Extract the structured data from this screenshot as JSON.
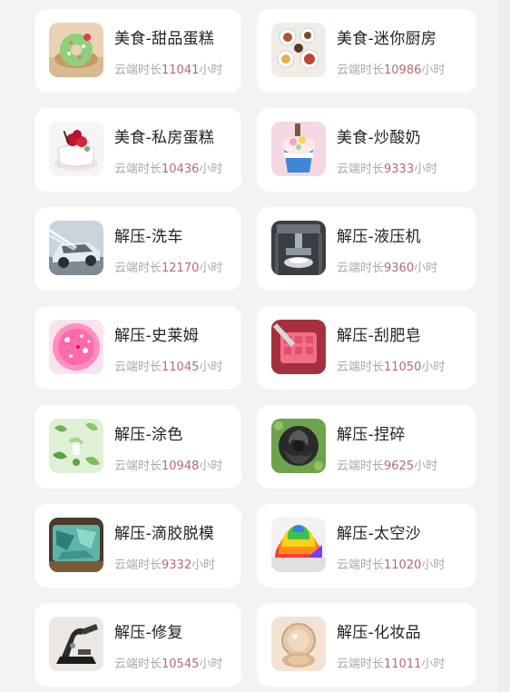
{
  "theme": {
    "page_bg": "#f3f3f5",
    "card_bg": "#ffffff",
    "title_color": "#222222",
    "meta_color": "#a9a9ad",
    "hours_color": "#b56a72"
  },
  "meta_prefix": "云端时长",
  "meta_suffix": "小时",
  "items": [
    {
      "title": "美食-甜品蛋糕",
      "hours": "11041",
      "icon": "donut-cake-image"
    },
    {
      "title": "美食-迷你厨房",
      "hours": "10986",
      "icon": "mini-kitchen-image"
    },
    {
      "title": "美食-私房蛋糕",
      "hours": "10436",
      "icon": "berry-cake-image"
    },
    {
      "title": "美食-炒酸奶",
      "hours": "9333",
      "icon": "fried-yogurt-image"
    },
    {
      "title": "解压-洗车",
      "hours": "12170",
      "icon": "car-wash-image"
    },
    {
      "title": "解压-液压机",
      "hours": "9360",
      "icon": "hydraulic-press-image"
    },
    {
      "title": "解压-史莱姆",
      "hours": "11045",
      "icon": "slime-image"
    },
    {
      "title": "解压-刮肥皂",
      "hours": "11050",
      "icon": "soap-cutting-image"
    },
    {
      "title": "解压-涂色",
      "hours": "10948",
      "icon": "coloring-image"
    },
    {
      "title": "解压-捏碎",
      "hours": "9625",
      "icon": "crush-image"
    },
    {
      "title": "解压-滴胶脱模",
      "hours": "9332",
      "icon": "resin-mold-image"
    },
    {
      "title": "解压-太空沙",
      "hours": "11020",
      "icon": "kinetic-sand-image"
    },
    {
      "title": "解压-修复",
      "hours": "10545",
      "icon": "repair-tool-image"
    },
    {
      "title": "解压-化妆品",
      "hours": "11011",
      "icon": "cosmetics-compact-image"
    }
  ]
}
